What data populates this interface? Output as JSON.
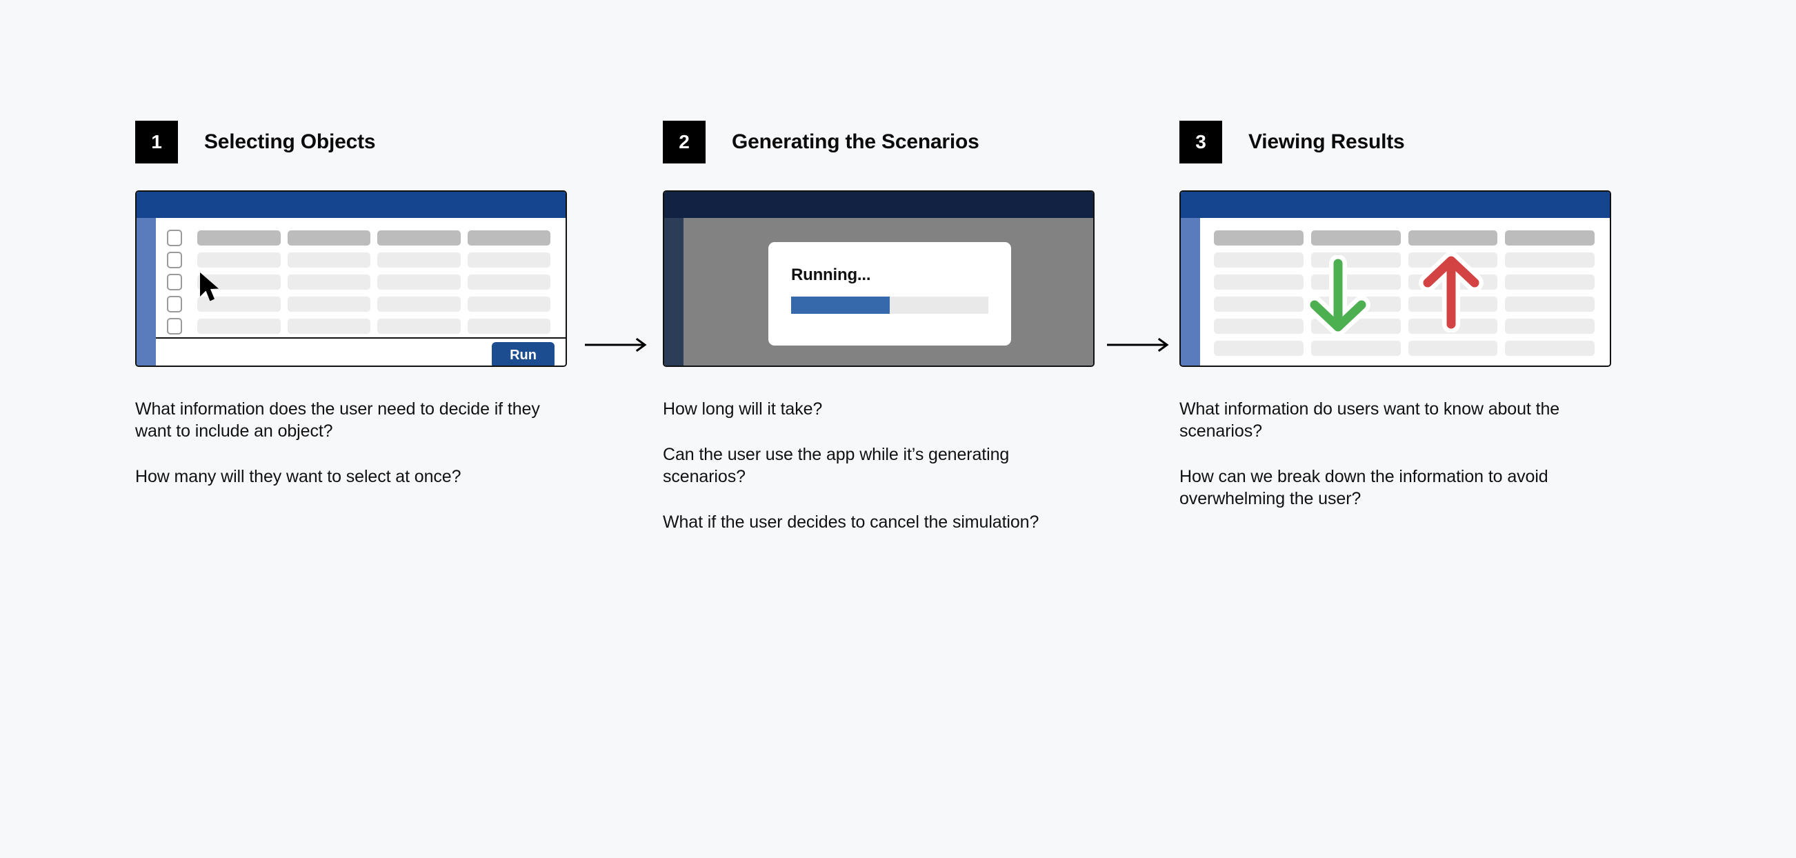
{
  "page": {
    "background_color": "#f7f8fa",
    "text_color": "#111111"
  },
  "colors": {
    "badge_bg": "#000000",
    "titlebar_blue": "#16458f",
    "titlebar_navy": "#122243",
    "sidebar_blue": "#5a7cbd",
    "sidebar_dark": "#2c3e57",
    "run_button": "#1c4d91",
    "progress_fill": "#3569ab",
    "progress_track": "#e9e9e9",
    "overlay_gray": "#828282",
    "header_cell": "#bcbcbc",
    "body_cell": "#ececec",
    "arrow_down_green": "#4caf50",
    "arrow_up_red": "#d34343"
  },
  "steps": [
    {
      "number": "1",
      "title": "Selecting Objects",
      "window": {
        "kind": "table-with-run",
        "checkbox_column": true,
        "header_row_cells": 4,
        "body_rows": 4,
        "body_row_cells": 4,
        "run_label": "Run",
        "cursor_visible": true
      },
      "captions": [
        "What information does the user need to decide if they want to include an object?",
        "How many will they want to select at once?"
      ]
    },
    {
      "number": "2",
      "title": "Generating the Scenarios",
      "window": {
        "kind": "busy-overlay",
        "dialog_title": "Running...",
        "progress_percent": 50
      },
      "captions": [
        "How long will it take?",
        "Can the user use the app while it’s generating scenarios?",
        "What if the user decides to cancel the simulation?"
      ]
    },
    {
      "number": "3",
      "title": "Viewing Results",
      "window": {
        "kind": "results-table",
        "checkbox_column": false,
        "header_row_cells": 4,
        "body_rows": 5,
        "body_row_cells": 4,
        "trend_icons": [
          "arrow-down-green",
          "arrow-up-red"
        ]
      },
      "captions": [
        "What information do users want to know about the scenarios?",
        "How can we break down the information to avoid overwhelming the user?"
      ]
    }
  ],
  "connectors": [
    {
      "name": "step-1-to-2-arrow",
      "direction": "right"
    },
    {
      "name": "step-2-to-3-arrow",
      "direction": "right"
    }
  ]
}
